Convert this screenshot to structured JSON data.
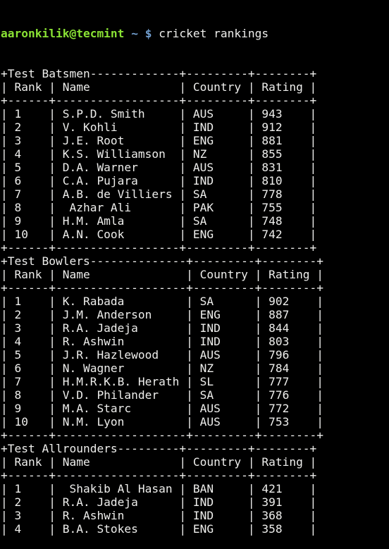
{
  "prompt": {
    "user_host": "aaronkilik@tecmint",
    "cwd": "~",
    "symbol": "$",
    "command": "cricket rankings"
  },
  "colors": {
    "background": "#000000",
    "text": "#eeeeec",
    "prompt_user": "#8ae234",
    "prompt_path": "#729fcf"
  },
  "tables": [
    {
      "title": "Test Batsmen",
      "headers": [
        "Rank",
        "Name",
        "Country",
        "Rating"
      ],
      "rows": [
        [
          "1",
          "S.P.D. Smith",
          "AUS",
          "943"
        ],
        [
          "2",
          "V. Kohli",
          "IND",
          "912"
        ],
        [
          "3",
          "J.E. Root",
          "ENG",
          "881"
        ],
        [
          "4",
          "K.S. Williamson",
          "NZ",
          "855"
        ],
        [
          "5",
          "D.A. Warner",
          "AUS",
          "831"
        ],
        [
          "6",
          "C.A. Pujara",
          "IND",
          "810"
        ],
        [
          "7",
          "A.B. de Villiers",
          "SA",
          "778"
        ],
        [
          "8",
          " Azhar Ali",
          "PAK",
          "755"
        ],
        [
          "9",
          "H.M. Amla",
          "SA",
          "748"
        ],
        [
          "10",
          "A.N. Cook",
          "ENG",
          "742"
        ]
      ],
      "closed": true
    },
    {
      "title": "Test Bowlers",
      "headers": [
        "Rank",
        "Name",
        "Country",
        "Rating"
      ],
      "rows": [
        [
          "1",
          "K. Rabada",
          "SA",
          "902"
        ],
        [
          "2",
          "J.M. Anderson",
          "ENG",
          "887"
        ],
        [
          "3",
          "R.A. Jadeja",
          "IND",
          "844"
        ],
        [
          "4",
          "R. Ashwin",
          "IND",
          "803"
        ],
        [
          "5",
          "J.R. Hazlewood",
          "AUS",
          "796"
        ],
        [
          "6",
          "N. Wagner",
          "NZ",
          "784"
        ],
        [
          "7",
          "H.M.R.K.B. Herath",
          "SL",
          "777"
        ],
        [
          "8",
          "V.D. Philander",
          "SA",
          "776"
        ],
        [
          "9",
          "M.A. Starc",
          "AUS",
          "772"
        ],
        [
          "10",
          "N.M. Lyon",
          "AUS",
          "753"
        ]
      ],
      "closed": true
    },
    {
      "title": "Test Allrounders",
      "headers": [
        "Rank",
        "Name",
        "Country",
        "Rating"
      ],
      "rows": [
        [
          "1",
          " Shakib Al Hasan",
          "BAN",
          "421"
        ],
        [
          "2",
          "R.A. Jadeja",
          "IND",
          "391"
        ],
        [
          "3",
          "R. Ashwin",
          "IND",
          "368"
        ],
        [
          "4",
          "B.A. Stokes",
          "ENG",
          "358"
        ]
      ],
      "closed": false
    }
  ]
}
